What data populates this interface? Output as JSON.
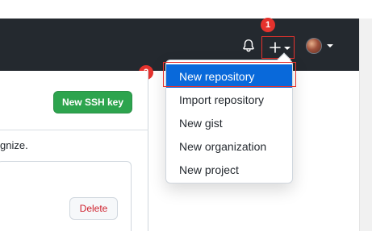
{
  "colors": {
    "header_bg": "#24292f",
    "primary_green": "#2da44e",
    "active_blue": "#0969da",
    "annotation_red": "#e5322d",
    "danger_text": "#cf222e"
  },
  "header": {
    "icons": [
      "bell-icon",
      "plus-icon",
      "caret-down-icon",
      "avatar"
    ]
  },
  "annotations": {
    "step1": "1",
    "step2": "2"
  },
  "main": {
    "new_ssh_key_label": "New SSH key",
    "organize_text": "gnize.",
    "delete_label": "Delete"
  },
  "dropdown": {
    "items": [
      {
        "label": "New repository",
        "active": true
      },
      {
        "label": "Import repository",
        "active": false
      },
      {
        "label": "New gist",
        "active": false
      },
      {
        "label": "New organization",
        "active": false
      },
      {
        "label": "New project",
        "active": false
      }
    ]
  }
}
